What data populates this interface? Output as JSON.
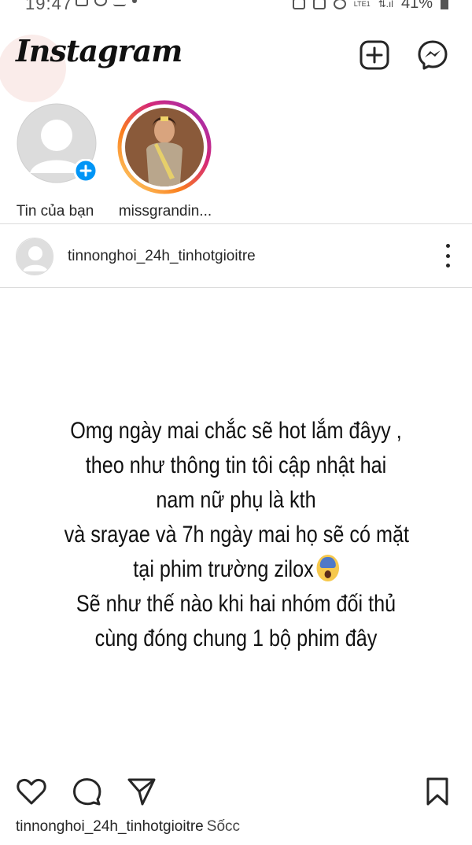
{
  "status_bar": {
    "time": "19:47",
    "network": "LTE1",
    "battery": "41%"
  },
  "header": {
    "logo_text": "Instagram",
    "new_post_icon": "plus-square-icon",
    "messenger_icon": "messenger-icon"
  },
  "stories": [
    {
      "label": "Tin của bạn",
      "type": "own",
      "badge_icon": "plus-circle-icon"
    },
    {
      "label": "missgrandin...",
      "type": "user",
      "ring": "gradient"
    }
  ],
  "post": {
    "username": "tinnonghoi_24h_tinhotgioitre",
    "menu_icon": "more-vertical-icon",
    "text_lines": [
      "Omg ngày mai chắc sẽ hot lắm đâyy ,",
      "theo như thông tin tôi cập nhật hai",
      "nam nữ phụ là kth",
      "và srayae và 7h ngày mai họ sẽ có mặt",
      "tại phim trường zilox",
      "Sẽ như thế nào khi hai nhóm đối thủ",
      "cùng đóng chung 1 bộ phim đây"
    ],
    "emoji": "screaming-face-emoji",
    "actions": {
      "like_icon": "heart-icon",
      "comment_icon": "comment-icon",
      "share_icon": "send-icon",
      "save_icon": "bookmark-icon"
    },
    "caption_user": "tinnonghoi_24h_tinhotgioitre",
    "caption_text": "Sốcc"
  }
}
